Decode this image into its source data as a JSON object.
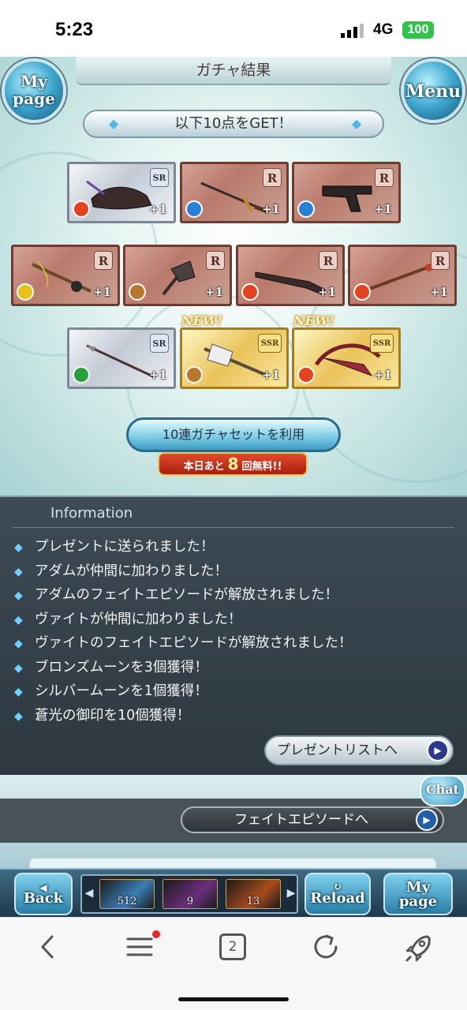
{
  "status": {
    "time": "5:23",
    "network": "4G",
    "battery": "100"
  },
  "header": {
    "title": "ガチャ結果",
    "left_button": [
      "My",
      "page"
    ],
    "right_button": "Menu"
  },
  "banner": {
    "text": "以下10点をGET！"
  },
  "cards": [
    {
      "rarity": "SR",
      "element": "fire",
      "plus": "+1",
      "weapon": "gauntlet",
      "new": ""
    },
    {
      "rarity": "R",
      "element": "water",
      "plus": "+1",
      "weapon": "dagger",
      "new": ""
    },
    {
      "rarity": "R",
      "element": "water",
      "plus": "+1",
      "weapon": "gun",
      "new": ""
    },
    {
      "rarity": "R",
      "element": "light",
      "plus": "+1",
      "weapon": "flail",
      "new": ""
    },
    {
      "rarity": "R",
      "element": "earth",
      "plus": "+1",
      "weapon": "axe",
      "new": ""
    },
    {
      "rarity": "R",
      "element": "fire",
      "plus": "+1",
      "weapon": "rifle",
      "new": ""
    },
    {
      "rarity": "R",
      "element": "fire",
      "plus": "+1",
      "weapon": "staff",
      "new": ""
    },
    {
      "rarity": "SR",
      "element": "wind",
      "plus": "+1",
      "weapon": "spear",
      "new": ""
    },
    {
      "rarity": "SSR",
      "element": "earth",
      "plus": "+1",
      "weapon": "halberd",
      "new": "NEW!"
    },
    {
      "rarity": "SSR",
      "element": "fire",
      "plus": "+1",
      "weapon": "bow",
      "new": "NEW!"
    }
  ],
  "gacha_button": {
    "label": "10連ガチャセットを利用"
  },
  "free_bar": {
    "prefix": "本日あと",
    "count": "8",
    "suffix": "回無料!!"
  },
  "info": {
    "heading": "Information",
    "lines": [
      "プレゼントに送られました！",
      "アダムが仲間に加わりました！",
      "アダムのフェイトエピソードが解放されました！",
      "ヴァイトが仲間に加わりました！",
      "ヴァイトのフェイトエピソードが解放されました！",
      "ブロンズムーンを3個獲得！",
      "シルバームーンを1個獲得！",
      "蒼光の御印を10個獲得！"
    ],
    "present_button": "プレゼントリストへ"
  },
  "chat_label": "Chat",
  "fate_button": "フェイトエピソードへ",
  "toolbar": {
    "back": "Back",
    "reload": "Reload",
    "mypage": [
      "My",
      "page"
    ],
    "items": [
      {
        "count": "512",
        "color": "#3a7fb6"
      },
      {
        "count": "9",
        "color": "#6b2f7d"
      },
      {
        "count": "13",
        "color": "#a84c1c"
      }
    ]
  },
  "browser": {
    "tab_count": "2"
  },
  "colors": {
    "fire": "#e2441f",
    "water": "#2a7fd6",
    "earth": "#b9772b",
    "wind": "#27a23a",
    "light": "#e6c21a",
    "dark": "#7a3aa8"
  }
}
